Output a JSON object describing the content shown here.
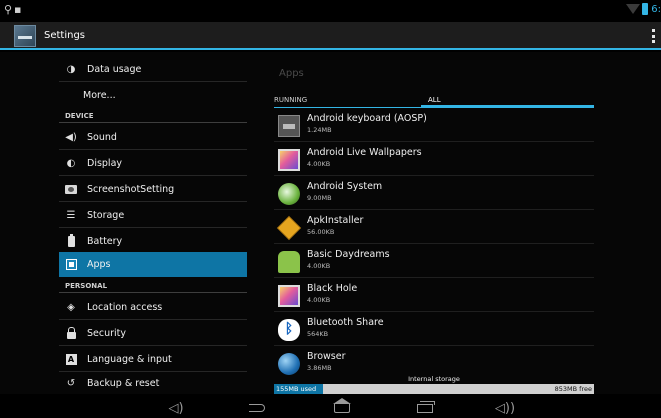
{
  "status_bar": {
    "left_icons": [
      "usb-icon",
      "notification-icon"
    ],
    "time": "6:",
    "accent": "#33b5e5"
  },
  "action_bar": {
    "title": "Settings"
  },
  "settings_list": {
    "items": [
      {
        "label": "Data usage",
        "icon": "data-usage-icon"
      },
      {
        "label": "More...",
        "icon": ""
      },
      {
        "header": "DEVICE"
      },
      {
        "label": "Sound",
        "icon": "speaker-icon"
      },
      {
        "label": "Display",
        "icon": "display-icon"
      },
      {
        "label": "ScreenshotSetting",
        "icon": "camera-icon"
      },
      {
        "label": "Storage",
        "icon": "storage-icon"
      },
      {
        "label": "Battery",
        "icon": "battery-icon"
      },
      {
        "label": "Apps",
        "icon": "apps-icon",
        "selected": true
      },
      {
        "header": "PERSONAL"
      },
      {
        "label": "Location access",
        "icon": "location-icon"
      },
      {
        "label": "Security",
        "icon": "lock-icon"
      },
      {
        "label": "Language & input",
        "icon": "language-icon"
      },
      {
        "label": "Backup & reset",
        "icon": "backup-icon"
      }
    ]
  },
  "apps_panel": {
    "title": "Apps",
    "tabs": [
      {
        "label": "RUNNING",
        "active": false
      },
      {
        "label": "ALL",
        "active": true
      }
    ],
    "apps": [
      {
        "name": "Android keyboard (AOSP)",
        "size": "1.24MB",
        "icon": "keyboard-icon"
      },
      {
        "name": "Android Live Wallpapers",
        "size": "4.00KB",
        "icon": "wallpaper-icon"
      },
      {
        "name": "Android System",
        "size": "9.00MB",
        "icon": "android-system-icon"
      },
      {
        "name": "ApkInstaller",
        "size": "56.00KB",
        "icon": "apk-installer-icon"
      },
      {
        "name": "Basic Daydreams",
        "size": "4.00KB",
        "icon": "android-icon"
      },
      {
        "name": "Black Hole",
        "size": "4.00KB",
        "icon": "wallpaper-icon"
      },
      {
        "name": "Bluetooth Share",
        "size": "564KB",
        "icon": "bluetooth-icon"
      },
      {
        "name": "Browser",
        "size": "3.86MB",
        "icon": "browser-icon"
      }
    ],
    "storage": {
      "label": "Internal storage",
      "used": "155MB used",
      "free": "853MB free",
      "used_fraction": 0.154
    }
  },
  "nav_bar": {
    "buttons": [
      "volume-down-icon",
      "back-icon",
      "home-icon",
      "recent-apps-icon",
      "volume-up-icon"
    ]
  }
}
